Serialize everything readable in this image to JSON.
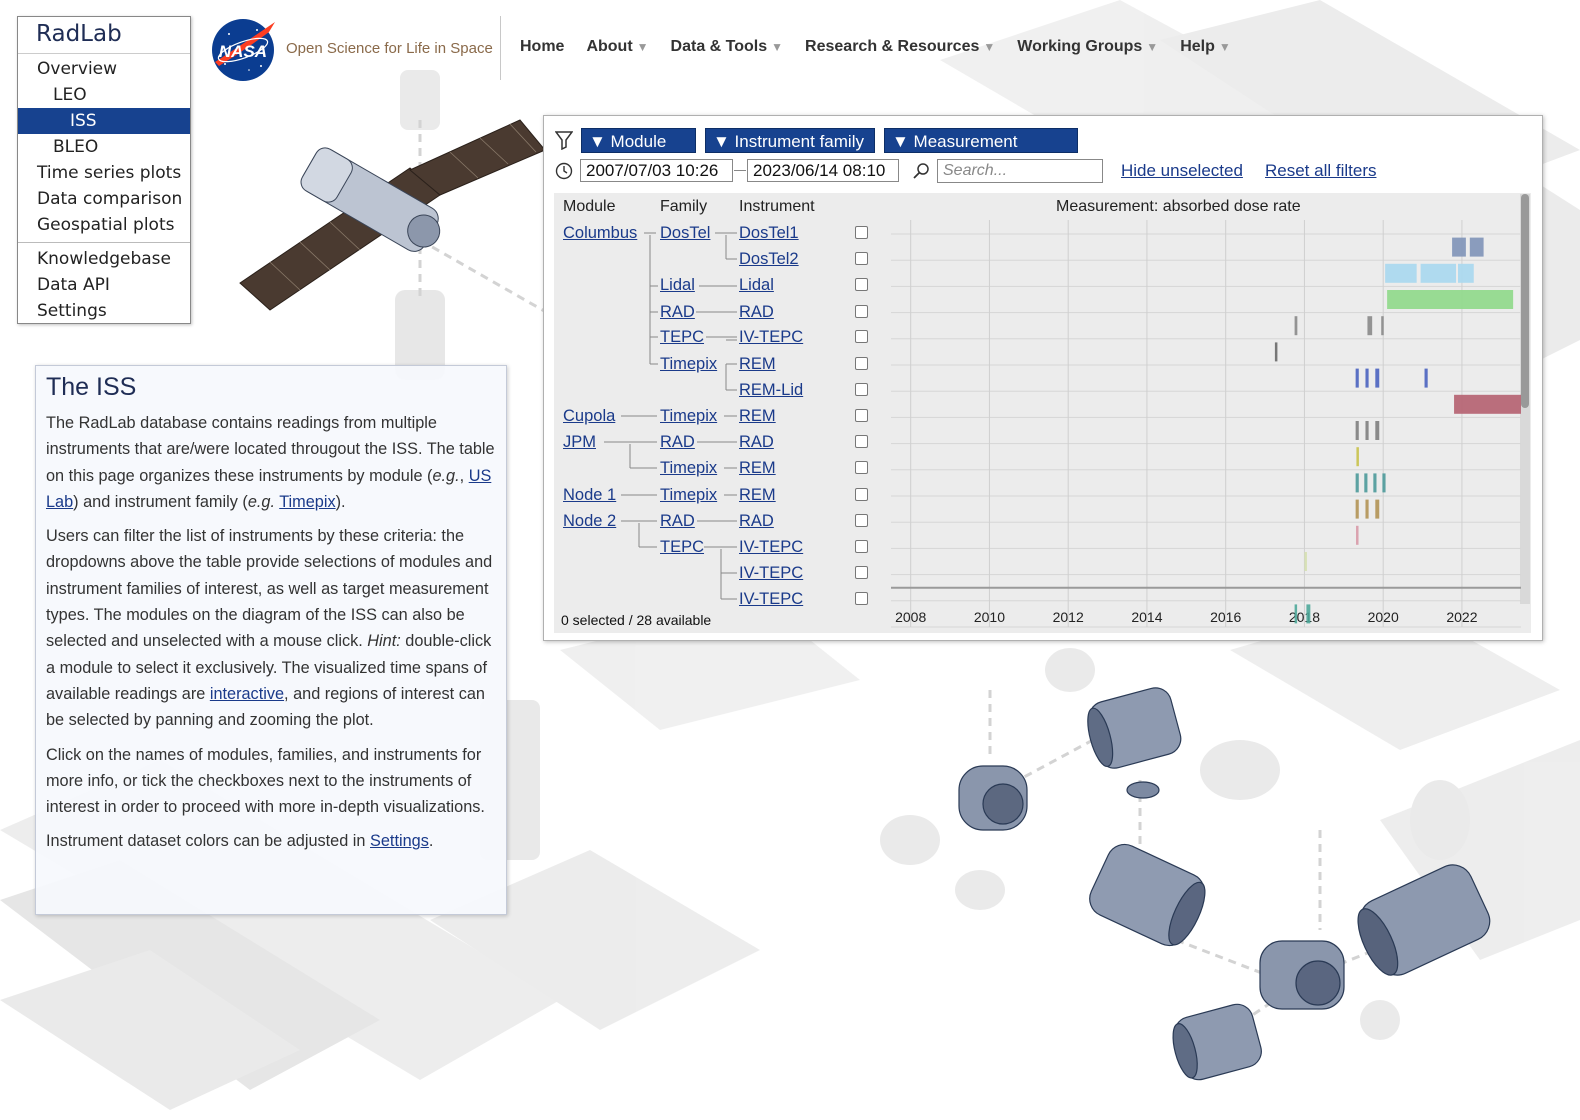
{
  "nav": {
    "brand": "RadLab",
    "items": [
      {
        "label": "Overview",
        "level": 1,
        "selected": false
      },
      {
        "label": "LEO",
        "level": 2,
        "selected": false
      },
      {
        "label": "ISS",
        "level": 3,
        "selected": true
      },
      {
        "label": "BLEO",
        "level": 2,
        "selected": false
      },
      {
        "label": "Time series plots",
        "level": 1,
        "selected": false
      },
      {
        "label": "Data comparison",
        "level": 1,
        "selected": false
      },
      {
        "label": "Geospatial plots",
        "level": 1,
        "selected": false
      }
    ],
    "items2": [
      {
        "label": "Knowledgebase"
      },
      {
        "label": "Data API"
      },
      {
        "label": "Settings"
      }
    ]
  },
  "header": {
    "logo_text": "NASA",
    "tagline": "Open Science for Life in Space",
    "menu": [
      {
        "label": "Home",
        "has_dropdown": false
      },
      {
        "label": "About",
        "has_dropdown": true
      },
      {
        "label": "Data & Tools",
        "has_dropdown": true
      },
      {
        "label": "Research & Resources",
        "has_dropdown": true
      },
      {
        "label": "Working Groups",
        "has_dropdown": true
      },
      {
        "label": "Help",
        "has_dropdown": true
      }
    ]
  },
  "info": {
    "title": "The ISS",
    "p1_a": "The RadLab database contains readings from multiple instruments that are/were located througout the ISS. The table on this page organizes these instruments by module (",
    "p1_eg1": "e.g.",
    "p1_b": ", ",
    "p1_link1": "US Lab",
    "p1_c": ") and instrument family (",
    "p1_eg2": "e.g.",
    "p1_d": " ",
    "p1_link2": "Timepix",
    "p1_e": ").",
    "p2_a": "Users can filter the list of instruments by these criteria: the dropdowns above the table provide selections of modules and instrument families of interest, as well as target measurement types. The modules on the diagram of the ISS can also be selected and unselected with a mouse click. ",
    "p2_hint": "Hint:",
    "p2_b": " double-click a module to select it exclusively. The visualized time spans of available readings are ",
    "p2_link": "interactive",
    "p2_c": ", and regions of interest can be selected by panning and zooming the plot.",
    "p3": "Click on the names of modules, families, and instruments for more info, or tick the checkboxes next to the instruments of interest in order to proceed with more in-depth visualizations.",
    "p4_a": "Instrument dataset colors can be adjusted in ",
    "p4_link": "Settings",
    "p4_b": "."
  },
  "filters": {
    "module_label": "▼ Module",
    "family_label": "▼ Instrument family",
    "measurement_label": "▼ Measurement",
    "date_start": "2007/07/03 10:26",
    "date_end": "2023/06/14 08:10",
    "search_placeholder": "Search...",
    "hide_unselected": "Hide unselected",
    "reset_filters": "Reset all filters"
  },
  "table": {
    "col_module": "Module",
    "col_family": "Family",
    "col_instrument": "Instrument",
    "plot_title": "Measurement: absorbed dose rate",
    "count_text": "0 selected / 28 available",
    "rows": [
      {
        "module": "Columbus",
        "family": "DosTel",
        "instrument": "DosTel1",
        "color": "#7f94b8"
      },
      {
        "module": "",
        "family": "",
        "instrument": "DosTel2",
        "color": "#a8d8f0"
      },
      {
        "module": "",
        "family": "Lidal",
        "instrument": "Lidal",
        "color": "#8fd98a"
      },
      {
        "module": "",
        "family": "RAD",
        "instrument": "RAD",
        "color": "#8a8a8a"
      },
      {
        "module": "",
        "family": "TEPC",
        "instrument": "IV-TEPC",
        "color": "#6a6a6a"
      },
      {
        "module": "",
        "family": "Timepix",
        "instrument": "REM",
        "color": "#4a63c0"
      },
      {
        "module": "",
        "family": "",
        "instrument": "REM-Lid",
        "color": "#b56070"
      },
      {
        "module": "Cupola",
        "family": "Timepix",
        "instrument": "REM",
        "color": "#808080"
      },
      {
        "module": "JPM",
        "family": "RAD",
        "instrument": "RAD",
        "color": "#c9c24a"
      },
      {
        "module": "",
        "family": "Timepix",
        "instrument": "REM",
        "color": "#4d9a9a"
      },
      {
        "module": "Node 1",
        "family": "Timepix",
        "instrument": "REM",
        "color": "#b39455"
      },
      {
        "module": "Node 2",
        "family": "RAD",
        "instrument": "RAD",
        "color": "#d89aa8"
      },
      {
        "module": "",
        "family": "TEPC",
        "instrument": "IV-TEPC",
        "color": "#d6e0b0"
      },
      {
        "module": "",
        "family": "",
        "instrument": "IV-TEPC",
        "color": "#9a9a9a"
      },
      {
        "module": "",
        "family": "",
        "instrument": "IV-TEPC",
        "color": "#4fa89a"
      }
    ]
  },
  "chart_data": {
    "type": "timeline",
    "title": "Measurement: absorbed dose rate",
    "xlim": [
      2007.5,
      2023.5
    ],
    "x_ticks": [
      "2008",
      "2010",
      "2012",
      "2014",
      "2016",
      "2018",
      "2020",
      "2022"
    ],
    "series": [
      {
        "name": "DosTel1",
        "spans": [
          [
            2021.75,
            2022.1
          ],
          [
            2022.2,
            2022.55
          ]
        ]
      },
      {
        "name": "DosTel2",
        "spans": [
          [
            2020.05,
            2020.85
          ],
          [
            2020.95,
            2021.85
          ],
          [
            2021.9,
            2022.3
          ]
        ]
      },
      {
        "name": "Lidal",
        "spans": [
          [
            2020.1,
            2023.3
          ]
        ]
      },
      {
        "name": "RAD",
        "spans": [
          [
            2017.75,
            2017.82
          ],
          [
            2019.6,
            2019.72
          ],
          [
            2019.95,
            2020.0
          ]
        ]
      },
      {
        "name": "IV-TEPC",
        "spans": [
          [
            2017.25,
            2017.3
          ]
        ]
      },
      {
        "name": "REM",
        "spans": [
          [
            2019.3,
            2019.38
          ],
          [
            2019.55,
            2019.63
          ],
          [
            2019.8,
            2019.9
          ],
          [
            2021.05,
            2021.13
          ]
        ]
      },
      {
        "name": "REM-Lid",
        "spans": [
          [
            2021.8,
            2023.5
          ]
        ]
      },
      {
        "name": "REM",
        "spans": [
          [
            2019.3,
            2019.38
          ],
          [
            2019.55,
            2019.63
          ],
          [
            2019.8,
            2019.9
          ]
        ]
      },
      {
        "name": "RAD",
        "spans": [
          [
            2019.32,
            2019.38
          ]
        ]
      },
      {
        "name": "REM",
        "spans": [
          [
            2019.3,
            2019.38
          ],
          [
            2019.52,
            2019.6
          ],
          [
            2019.75,
            2019.83
          ],
          [
            2019.98,
            2020.06
          ]
        ]
      },
      {
        "name": "REM",
        "spans": [
          [
            2019.3,
            2019.38
          ],
          [
            2019.55,
            2019.63
          ],
          [
            2019.8,
            2019.9
          ]
        ]
      },
      {
        "name": "RAD",
        "spans": [
          [
            2019.31,
            2019.35
          ]
        ]
      },
      {
        "name": "IV-TEPC",
        "spans": [
          [
            2018.0,
            2018.04
          ]
        ]
      },
      {
        "name": "IV-TEPC",
        "spans": [
          [
            2007.5,
            2023.5
          ]
        ]
      },
      {
        "name": "IV-TEPC",
        "spans": [
          [
            2017.75,
            2017.8
          ],
          [
            2018.05,
            2018.15
          ]
        ]
      }
    ]
  }
}
